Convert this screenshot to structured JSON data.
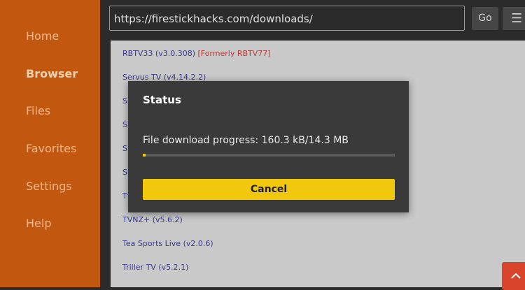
{
  "sidebar": {
    "items": [
      {
        "label": "Home",
        "active": false
      },
      {
        "label": "Browser",
        "active": true
      },
      {
        "label": "Files",
        "active": false
      },
      {
        "label": "Favorites",
        "active": false
      },
      {
        "label": "Settings",
        "active": false
      },
      {
        "label": "Help",
        "active": false
      }
    ]
  },
  "toolbar": {
    "url": "https://firestickhacks.com/downloads/",
    "go_label": "Go",
    "menu_icon": "menu-icon"
  },
  "downloads": {
    "visible_items": [
      {
        "name": "RBTV33 (v3.0.308)",
        "note": "[Formerly RBTV77]"
      },
      {
        "name": "Servus TV (v4.14.2.2)",
        "note": ""
      },
      {
        "name": "Sp",
        "note": ""
      },
      {
        "name": "Sp",
        "note": ""
      },
      {
        "name": "Sp",
        "note": ""
      },
      {
        "name": "St",
        "note": ""
      },
      {
        "name": "Tf",
        "note": ""
      },
      {
        "name": "TVNZ+ (v5.6.2)",
        "note": ""
      },
      {
        "name": "Tea Sports Live (v2.0.6)",
        "note": ""
      },
      {
        "name": "Triller TV (v5.2.1)",
        "note": ""
      }
    ]
  },
  "dialog": {
    "title": "Status",
    "message": "File download progress: 160.3 kB/14.3 MB",
    "progress_fraction": 0.011,
    "cancel_label": "Cancel"
  },
  "colors": {
    "sidebar_bg": "#c2570f",
    "accent_yellow": "#f2c80f",
    "fab_red": "#d8452c"
  },
  "fab": {
    "icon": "chevron-up-icon"
  }
}
